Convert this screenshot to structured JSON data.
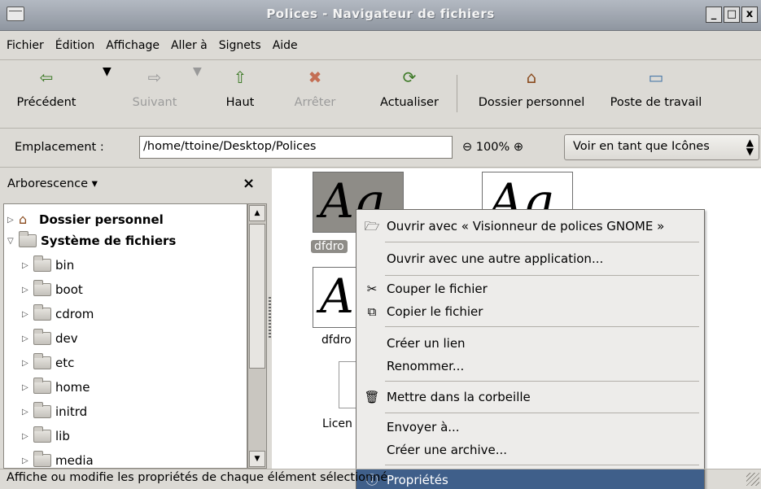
{
  "window": {
    "title": "Polices - Navigateur de fichiers",
    "buttons": [
      "_",
      "□",
      "x"
    ]
  },
  "menubar": [
    {
      "label": "Fichier"
    },
    {
      "label": "Édition"
    },
    {
      "label": "Affichage"
    },
    {
      "label": "Aller à"
    },
    {
      "label": "Signets"
    },
    {
      "label": "Aide"
    }
  ],
  "toolbar": {
    "back": "Précédent",
    "forward": "Suivant",
    "up": "Haut",
    "stop": "Arrêter",
    "reload": "Actualiser",
    "home": "Dossier personnel",
    "computer": "Poste de travail"
  },
  "location": {
    "label": "Emplacement :",
    "path": "/home/ttoine/Desktop/Polices",
    "zoom": "100%",
    "view_mode": "Voir en tant que Icônes"
  },
  "sidebar": {
    "header": "Arborescence",
    "tree": [
      {
        "label": "Dossier personnel",
        "bold": true
      },
      {
        "label": "Système de fichiers",
        "bold": true
      },
      {
        "label": "bin"
      },
      {
        "label": "boot"
      },
      {
        "label": "cdrom"
      },
      {
        "label": "dev"
      },
      {
        "label": "etc"
      },
      {
        "label": "home"
      },
      {
        "label": "initrd"
      },
      {
        "label": "lib"
      },
      {
        "label": "media"
      }
    ]
  },
  "files": [
    {
      "glyph": "Ag",
      "label": "dfdro",
      "selected": true
    },
    {
      "glyph": "Ag",
      "label": ""
    },
    {
      "glyph": "A",
      "label": "dfdro"
    },
    {
      "glyph": "",
      "label": "Licen"
    }
  ],
  "context_menu": [
    {
      "label": "Ouvrir avec « Visionneur de polices GNOME »",
      "icon": "open-folder-icon"
    },
    {
      "label": "Ouvrir avec une autre application..."
    },
    {
      "label": "Couper le fichier",
      "icon": "scissors-icon"
    },
    {
      "label": "Copier le fichier",
      "icon": "copy-icon"
    },
    {
      "label": "Créer un lien"
    },
    {
      "label": "Renommer..."
    },
    {
      "label": "Mettre dans la corbeille",
      "icon": "trash-icon"
    },
    {
      "label": "Envoyer à..."
    },
    {
      "label": "Créer une archive..."
    },
    {
      "label": "Propriétés",
      "icon": "properties-icon",
      "highlighted": true
    }
  ],
  "statusbar": {
    "text": "Affiche ou modifie les propriétés de chaque élément sélectionné"
  },
  "colors": {
    "highlight": "#3f5f8a",
    "selection": "#8e8c87",
    "titlebar": "#a2a8b1"
  }
}
